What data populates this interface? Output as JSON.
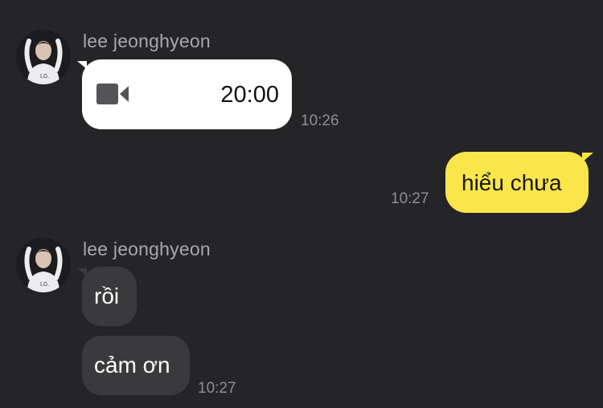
{
  "colors": {
    "background": "#252527",
    "incoming_bubble": "#3a3a3d",
    "outgoing_bubble": "#fae54b",
    "call_bubble": "#ffffff",
    "name_text": "#a8a8ad",
    "time_text": "#8f8f94"
  },
  "conversation": {
    "group1": {
      "sender_name": "lee jeonghyeon",
      "call_message": {
        "icon": "video-camera-icon",
        "duration": "20:00"
      },
      "time": "10:26"
    },
    "outgoing": {
      "text": "hiểu chưa",
      "time": "10:27"
    },
    "group2": {
      "sender_name": "lee jeonghyeon",
      "messages": [
        {
          "text": "rồi"
        },
        {
          "text": "cảm ơn"
        }
      ],
      "time": "10:27"
    }
  }
}
